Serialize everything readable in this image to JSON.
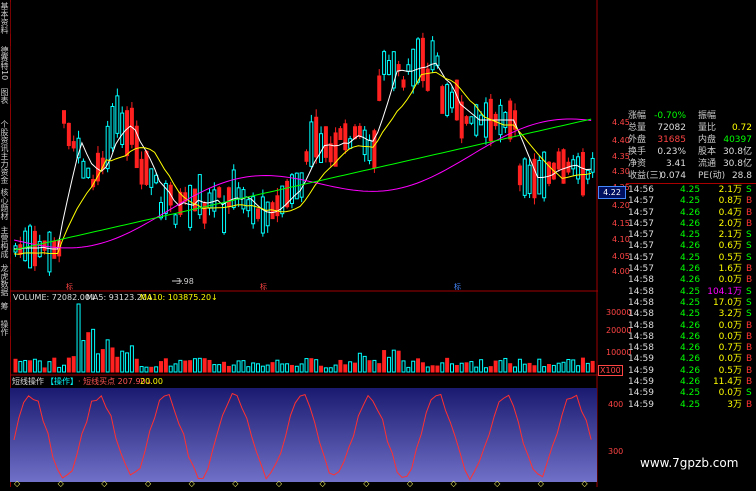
{
  "side_tabs": [
    "基本资料",
    "德赛特10",
    "图表",
    "个股资讯",
    "主力资金",
    "核心题材",
    "主营构成",
    "龙虎数据",
    "筹",
    "操作"
  ],
  "price_axis": {
    "ticks": [
      "4.45",
      "4.40",
      "4.35",
      "4.30",
      "4.25",
      "4.20",
      "4.15",
      "4.10",
      "4.05",
      "4.00"
    ],
    "current": "4.22"
  },
  "main_chart": {
    "low_label": "3.98",
    "markers": [
      "标",
      "标",
      "标"
    ]
  },
  "volume_panel": {
    "title": "VOLUME: 72082.00↓",
    "ma5": "MA5: 93123.20↓",
    "ma10": "MA10: 103875.20↓",
    "ticks": [
      "30000",
      "20000",
      "10000"
    ],
    "unit": "X100"
  },
  "indicator_panel": {
    "name": "短线操作",
    "tag": "【操作】",
    "line1": "· 短线买点 207.90↓",
    "line2": "20.00",
    "ticks": [
      "400",
      "300"
    ]
  },
  "quote": {
    "rows": [
      {
        "l1": "涨幅",
        "v1": "-0.70%",
        "l2": "振幅",
        "v2": ""
      },
      {
        "l1": "总量",
        "v1": "72082",
        "l2": "量比",
        "v2": "0.72"
      },
      {
        "l1": "外盘",
        "v1": "31685",
        "l2": "内盘",
        "v2": "40397"
      },
      {
        "l1": "换手",
        "v1": "0.23%",
        "l2": "股本",
        "v2": "30.8亿"
      },
      {
        "l1": "净资",
        "v1": "3.41",
        "l2": "流通",
        "v2": "30.8亿"
      },
      {
        "l1": "收益(三)",
        "v1": "0.074",
        "l2": "PE(动)",
        "v2": "28.8"
      }
    ]
  },
  "ticks_list": [
    {
      "t": "14:56",
      "p": "4.25",
      "v": "2.1万",
      "s": "S"
    },
    {
      "t": "14:57",
      "p": "4.25",
      "v": "0.8万",
      "s": "B"
    },
    {
      "t": "14:57",
      "p": "4.26",
      "v": "0.4万",
      "s": "B"
    },
    {
      "t": "14:57",
      "p": "4.26",
      "v": "2.0万",
      "s": "B"
    },
    {
      "t": "14:57",
      "p": "4.25",
      "v": "2.1万",
      "s": "S"
    },
    {
      "t": "14:57",
      "p": "4.26",
      "v": "0.6万",
      "s": "S"
    },
    {
      "t": "14:57",
      "p": "4.25",
      "v": "0.5万",
      "s": "S"
    },
    {
      "t": "14:57",
      "p": "4.26",
      "v": "1.6万",
      "s": "B"
    },
    {
      "t": "14:58",
      "p": "4.26",
      "v": "0.0万",
      "s": "B"
    },
    {
      "t": "14:58",
      "p": "4.25",
      "v": "104.1万",
      "s": "S"
    },
    {
      "t": "14:58",
      "p": "4.25",
      "v": "17.0万",
      "s": "S"
    },
    {
      "t": "14:58",
      "p": "4.25",
      "v": "3.2万",
      "s": "S"
    },
    {
      "t": "14:58",
      "p": "4.26",
      "v": "0.0万",
      "s": "B"
    },
    {
      "t": "14:58",
      "p": "4.26",
      "v": "0.0万",
      "s": "B"
    },
    {
      "t": "14:58",
      "p": "4.26",
      "v": "0.7万",
      "s": "B"
    },
    {
      "t": "14:59",
      "p": "4.26",
      "v": "0.0万",
      "s": "B"
    },
    {
      "t": "14:59",
      "p": "4.26",
      "v": "0.5万",
      "s": "B"
    },
    {
      "t": "14:59",
      "p": "4.26",
      "v": "11.4万",
      "s": "B"
    },
    {
      "t": "14:59",
      "p": "4.25",
      "v": "0.0万",
      "s": "S"
    },
    {
      "t": "14:59",
      "p": "4.25",
      "v": "3万",
      "s": "B"
    }
  ],
  "watermark": "www.7gpzb.com",
  "colors": {
    "up": "#00ffff",
    "down": "#ff2020",
    "ma_white": "#ffffff",
    "ma_yellow": "#ffff00",
    "ma_purple": "#ff00ff",
    "ma_green": "#00ff00"
  }
}
